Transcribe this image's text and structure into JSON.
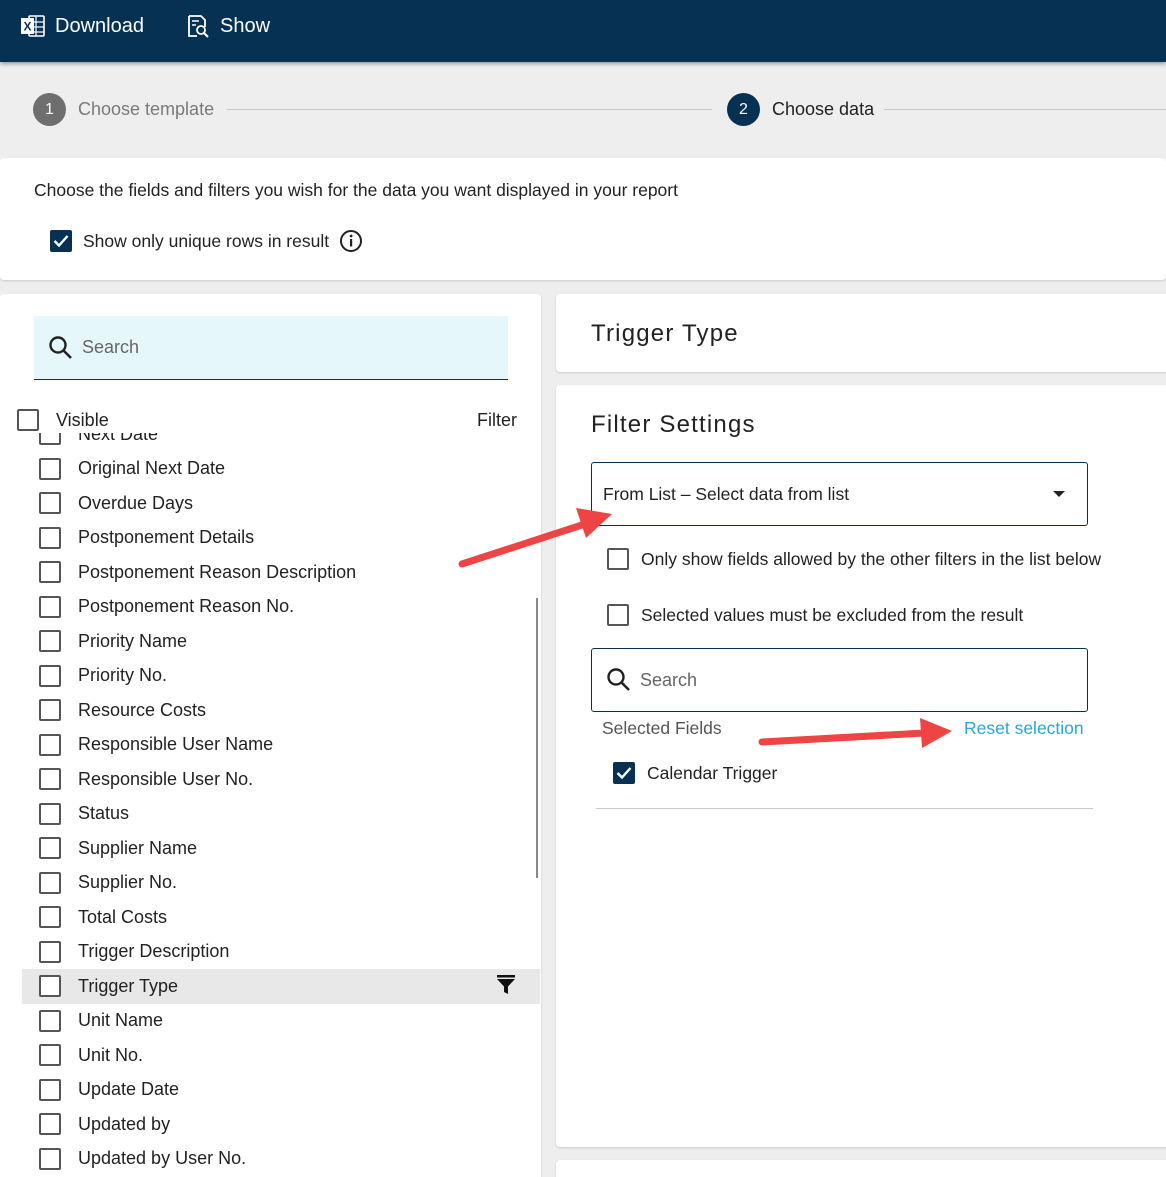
{
  "toolbar": {
    "download_label": "Download",
    "show_label": "Show"
  },
  "stepper": {
    "steps": [
      {
        "number": "1",
        "label": "Choose template"
      },
      {
        "number": "2",
        "label": "Choose data"
      }
    ]
  },
  "intro": {
    "text": "Choose the fields and filters you wish for the data you want displayed in your report",
    "unique_rows_label": "Show only unique rows in result",
    "unique_rows_checked": true
  },
  "field_list": {
    "search_placeholder": "Search",
    "visible_label": "Visible",
    "filter_label": "Filter",
    "items": [
      "Next Date",
      "Original Next Date",
      "Overdue Days",
      "Postponement Details",
      "Postponement Reason Description",
      "Postponement Reason No.",
      "Priority Name",
      "Priority No.",
      "Resource Costs",
      "Responsible User Name",
      "Responsible User No.",
      "Status",
      "Supplier Name",
      "Supplier No.",
      "Total Costs",
      "Trigger Description",
      "Trigger Type",
      "Unit Name",
      "Unit No.",
      "Update Date",
      "Updated by",
      "Updated by User No."
    ],
    "active_item": "Trigger Type"
  },
  "detail": {
    "title": "Trigger Type",
    "filter_settings_title": "Filter Settings",
    "filter_mode_value": "From List – Select data from list",
    "option_only_allowed": "Only show fields allowed by the other filters in the list below",
    "option_exclude": "Selected values must be excluded from the result",
    "search_placeholder": "Search",
    "selected_fields_label": "Selected Fields",
    "reset_label": "Reset selection",
    "selected_values": [
      "Calendar Trigger"
    ]
  },
  "colors": {
    "toolbar_bg": "#073153",
    "accent": "#073153",
    "link": "#2aa6d9",
    "annotation_arrow": "#ee4444"
  }
}
